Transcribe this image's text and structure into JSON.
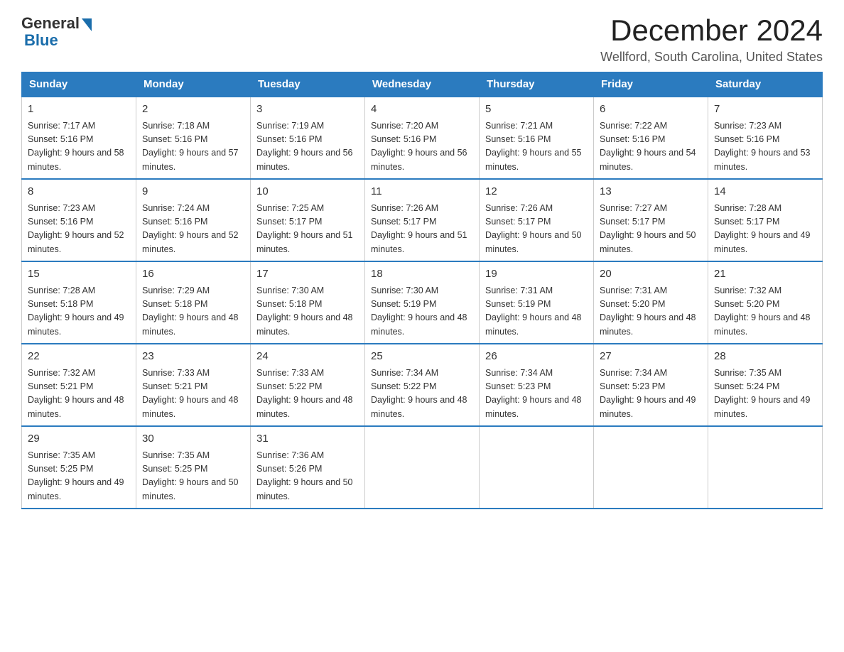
{
  "header": {
    "logo_general": "General",
    "logo_blue": "Blue",
    "title": "December 2024",
    "location": "Wellford, South Carolina, United States"
  },
  "weekdays": [
    "Sunday",
    "Monday",
    "Tuesday",
    "Wednesday",
    "Thursday",
    "Friday",
    "Saturday"
  ],
  "weeks": [
    [
      {
        "day": "1",
        "sunrise": "7:17 AM",
        "sunset": "5:16 PM",
        "daylight": "9 hours and 58 minutes."
      },
      {
        "day": "2",
        "sunrise": "7:18 AM",
        "sunset": "5:16 PM",
        "daylight": "9 hours and 57 minutes."
      },
      {
        "day": "3",
        "sunrise": "7:19 AM",
        "sunset": "5:16 PM",
        "daylight": "9 hours and 56 minutes."
      },
      {
        "day": "4",
        "sunrise": "7:20 AM",
        "sunset": "5:16 PM",
        "daylight": "9 hours and 56 minutes."
      },
      {
        "day": "5",
        "sunrise": "7:21 AM",
        "sunset": "5:16 PM",
        "daylight": "9 hours and 55 minutes."
      },
      {
        "day": "6",
        "sunrise": "7:22 AM",
        "sunset": "5:16 PM",
        "daylight": "9 hours and 54 minutes."
      },
      {
        "day": "7",
        "sunrise": "7:23 AM",
        "sunset": "5:16 PM",
        "daylight": "9 hours and 53 minutes."
      }
    ],
    [
      {
        "day": "8",
        "sunrise": "7:23 AM",
        "sunset": "5:16 PM",
        "daylight": "9 hours and 52 minutes."
      },
      {
        "day": "9",
        "sunrise": "7:24 AM",
        "sunset": "5:16 PM",
        "daylight": "9 hours and 52 minutes."
      },
      {
        "day": "10",
        "sunrise": "7:25 AM",
        "sunset": "5:17 PM",
        "daylight": "9 hours and 51 minutes."
      },
      {
        "day": "11",
        "sunrise": "7:26 AM",
        "sunset": "5:17 PM",
        "daylight": "9 hours and 51 minutes."
      },
      {
        "day": "12",
        "sunrise": "7:26 AM",
        "sunset": "5:17 PM",
        "daylight": "9 hours and 50 minutes."
      },
      {
        "day": "13",
        "sunrise": "7:27 AM",
        "sunset": "5:17 PM",
        "daylight": "9 hours and 50 minutes."
      },
      {
        "day": "14",
        "sunrise": "7:28 AM",
        "sunset": "5:17 PM",
        "daylight": "9 hours and 49 minutes."
      }
    ],
    [
      {
        "day": "15",
        "sunrise": "7:28 AM",
        "sunset": "5:18 PM",
        "daylight": "9 hours and 49 minutes."
      },
      {
        "day": "16",
        "sunrise": "7:29 AM",
        "sunset": "5:18 PM",
        "daylight": "9 hours and 48 minutes."
      },
      {
        "day": "17",
        "sunrise": "7:30 AM",
        "sunset": "5:18 PM",
        "daylight": "9 hours and 48 minutes."
      },
      {
        "day": "18",
        "sunrise": "7:30 AM",
        "sunset": "5:19 PM",
        "daylight": "9 hours and 48 minutes."
      },
      {
        "day": "19",
        "sunrise": "7:31 AM",
        "sunset": "5:19 PM",
        "daylight": "9 hours and 48 minutes."
      },
      {
        "day": "20",
        "sunrise": "7:31 AM",
        "sunset": "5:20 PM",
        "daylight": "9 hours and 48 minutes."
      },
      {
        "day": "21",
        "sunrise": "7:32 AM",
        "sunset": "5:20 PM",
        "daylight": "9 hours and 48 minutes."
      }
    ],
    [
      {
        "day": "22",
        "sunrise": "7:32 AM",
        "sunset": "5:21 PM",
        "daylight": "9 hours and 48 minutes."
      },
      {
        "day": "23",
        "sunrise": "7:33 AM",
        "sunset": "5:21 PM",
        "daylight": "9 hours and 48 minutes."
      },
      {
        "day": "24",
        "sunrise": "7:33 AM",
        "sunset": "5:22 PM",
        "daylight": "9 hours and 48 minutes."
      },
      {
        "day": "25",
        "sunrise": "7:34 AM",
        "sunset": "5:22 PM",
        "daylight": "9 hours and 48 minutes."
      },
      {
        "day": "26",
        "sunrise": "7:34 AM",
        "sunset": "5:23 PM",
        "daylight": "9 hours and 48 minutes."
      },
      {
        "day": "27",
        "sunrise": "7:34 AM",
        "sunset": "5:23 PM",
        "daylight": "9 hours and 49 minutes."
      },
      {
        "day": "28",
        "sunrise": "7:35 AM",
        "sunset": "5:24 PM",
        "daylight": "9 hours and 49 minutes."
      }
    ],
    [
      {
        "day": "29",
        "sunrise": "7:35 AM",
        "sunset": "5:25 PM",
        "daylight": "9 hours and 49 minutes."
      },
      {
        "day": "30",
        "sunrise": "7:35 AM",
        "sunset": "5:25 PM",
        "daylight": "9 hours and 50 minutes."
      },
      {
        "day": "31",
        "sunrise": "7:36 AM",
        "sunset": "5:26 PM",
        "daylight": "9 hours and 50 minutes."
      },
      null,
      null,
      null,
      null
    ]
  ]
}
